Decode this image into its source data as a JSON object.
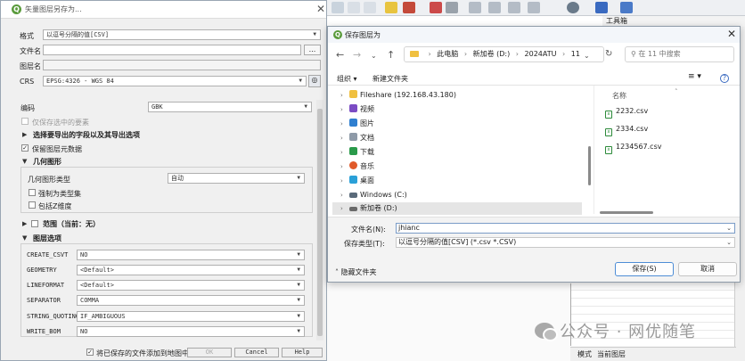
{
  "background_app": {
    "panel_title": "工具箱",
    "status_mode": "模式",
    "status_layer": "当前图层",
    "watermark": "公众号 · 网优随笔"
  },
  "qgis_dialog": {
    "title": "矢量图层另存为...",
    "format_label": "格式",
    "format_value": "以逗号分隔的值[CSV]",
    "filename_label": "文件名",
    "browse_label": "...",
    "layername_label": "图层名",
    "crs_label": "CRS",
    "crs_value": "EPSG:4326 - WGS 84",
    "encoding_label": "编码",
    "encoding_value": "GBK",
    "only_selected_label": "仅保存选中的要素",
    "select_fields_label": "选择要导出的字段以及其导出选项",
    "persist_metadata_label": "保留图层元数据",
    "geometry_section": "几何图形",
    "geometry_type_label": "几何图形类型",
    "geometry_type_value": "自动",
    "force_multi_label": "强制为类型集",
    "include_z_label": "包括Z维度",
    "extent_label": "范围（当前：无）",
    "layer_options_section": "图层选项",
    "layer_options": [
      {
        "key": "CREATE_CSVT",
        "value": "NO"
      },
      {
        "key": "GEOMETRY",
        "value": "<Default>"
      },
      {
        "key": "LINEFORMAT",
        "value": "<Default>"
      },
      {
        "key": "SEPARATOR",
        "value": "COMMA"
      },
      {
        "key": "STRING_QUOTING",
        "value": "IF_AMBIGUOUS"
      },
      {
        "key": "WRITE_BOM",
        "value": "NO"
      }
    ],
    "add_to_map_label": "将已保存的文件添加到地图中",
    "ok_label": "OK",
    "cancel_label": "Cancel",
    "help_label": "Help"
  },
  "save_dialog": {
    "title": "保存图层为",
    "breadcrumb": [
      "此电脑",
      "新加卷 (D:)",
      "2024ATU",
      "11"
    ],
    "search_placeholder": "在 11 中搜索",
    "organize_label": "组织 ▾",
    "new_folder_label": "新建文件夹",
    "tree": [
      {
        "label": "Fileshare (192.168.43.180)",
        "color": "#f0c040"
      },
      {
        "label": "视频",
        "color": "#7b4cc4"
      },
      {
        "label": "图片",
        "color": "#2f7fd0"
      },
      {
        "label": "文档",
        "color": "#8e9aa8"
      },
      {
        "label": "下载",
        "color": "#2a9a4a"
      },
      {
        "label": "音乐",
        "color": "#e05a2a"
      },
      {
        "label": "桌面",
        "color": "#2aa0d8"
      },
      {
        "label": "Windows (C:)",
        "color": "#5a6a7a"
      },
      {
        "label": "新加卷 (D:)",
        "color": "#6a6a6a"
      }
    ],
    "column_header": "名称",
    "files": [
      "2232.csv",
      "2334.csv",
      "1234567.csv"
    ],
    "filename_label": "文件名(N):",
    "filename_value": "jhianc",
    "filetype_label": "保存类型(T):",
    "filetype_value": "以逗号分隔的值[CSV] (*.csv *.CSV)",
    "hide_folders_label": "隐藏文件夹",
    "save_label": "保存(S)",
    "cancel_label": "取消"
  }
}
